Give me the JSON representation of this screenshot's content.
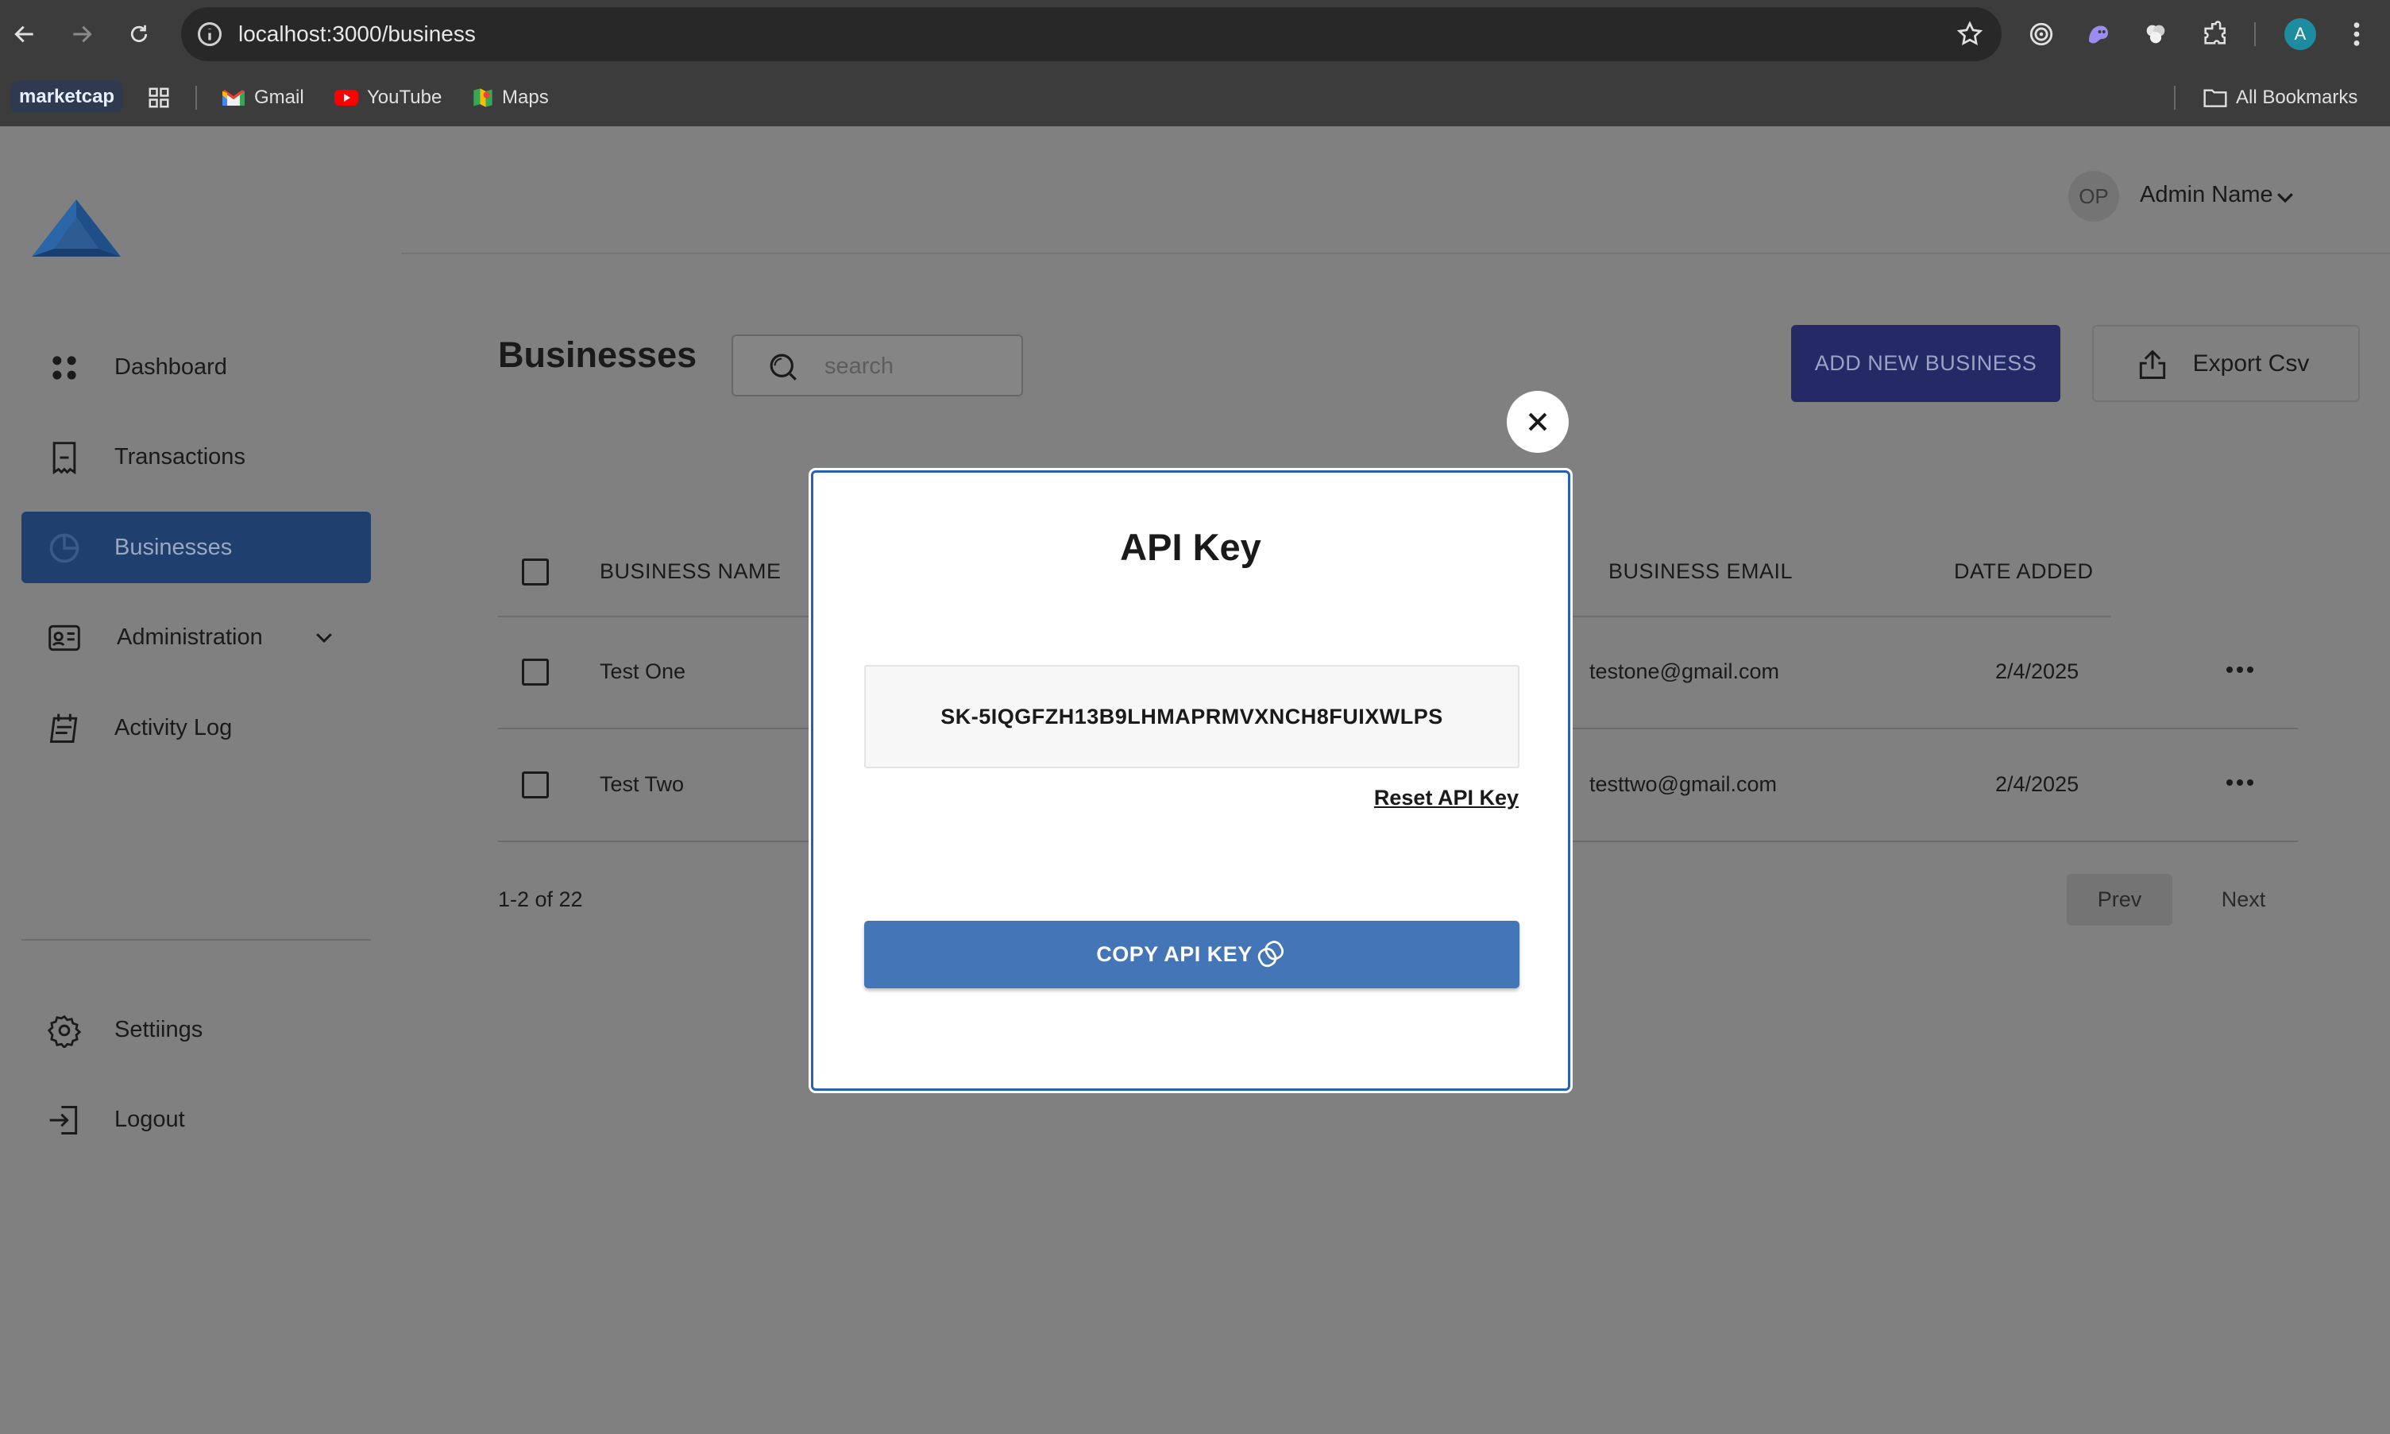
{
  "browser": {
    "url": "localhost:3000/business",
    "bookmarks": {
      "marketcap": "marketcap",
      "gmail": "Gmail",
      "youtube": "YouTube",
      "maps": "Maps",
      "all_bookmarks": "All Bookmarks"
    },
    "profile_initial": "A"
  },
  "sidebar": {
    "items": [
      {
        "label": "Dashboard",
        "icon": "grid-dots-icon"
      },
      {
        "label": "Transactions",
        "icon": "receipt-icon"
      },
      {
        "label": "Businesses",
        "icon": "pie-chart-icon",
        "active": true
      },
      {
        "label": "Administration",
        "icon": "id-card-icon",
        "expandable": true
      },
      {
        "label": "Activity Log",
        "icon": "calendar-log-icon"
      }
    ],
    "bottom_items": [
      {
        "label": "Settiings",
        "icon": "gear-icon"
      },
      {
        "label": "Logout",
        "icon": "logout-icon"
      }
    ]
  },
  "header": {
    "avatar_initials": "OP",
    "admin_name": "Admin Name"
  },
  "main": {
    "title": "Businesses",
    "search_placeholder": "search",
    "add_button": "ADD NEW BUSINESS",
    "export_button": "Export Csv",
    "table": {
      "columns": [
        "BUSINESS NAME",
        "BUSINESS EMAIL",
        "DATE ADDED"
      ],
      "rows": [
        {
          "name": "Test One",
          "email": "testone@gmail.com",
          "date": "2/4/2025"
        },
        {
          "name": "Test Two",
          "email": "testtwo@gmail.com",
          "date": "2/4/2025"
        }
      ]
    },
    "pagination": {
      "info": "1-2 of 22",
      "prev": "Prev",
      "next": "Next"
    }
  },
  "modal": {
    "title": "API Key",
    "api_key": "SK-5IQGFZH13B9LHMAPRMVXNCH8FUIXWLPS",
    "reset_link": "Reset API Key",
    "copy_button": "COPY API KEY"
  },
  "colors": {
    "accent": "#4475b7",
    "active_nav": "#1f3f6e",
    "add_button": "#232a66",
    "overlay": "#808080",
    "modal_border": "#2860b8"
  }
}
